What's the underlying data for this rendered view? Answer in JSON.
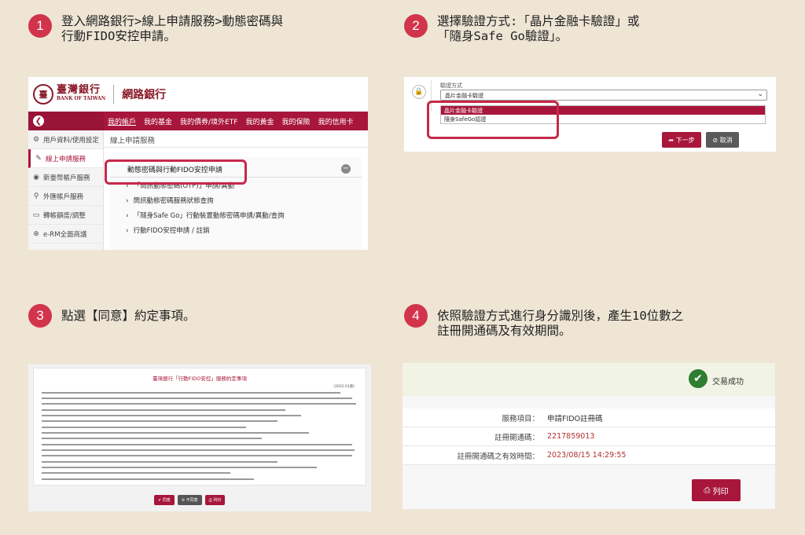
{
  "steps": [
    {
      "num": "1",
      "line1": "登入網路銀行>線上申請服務>動態密碼與",
      "line2": "行動FIDO安控申請。"
    },
    {
      "num": "2",
      "line1": "選擇驗證方式:「晶片金融卡驗證」或",
      "line2": "「隨身Safe Go驗證」。"
    },
    {
      "num": "3",
      "line1": "點選【同意】約定事項。"
    },
    {
      "num": "4",
      "line1": "依照驗證方式進行身分識別後，產生10位數之",
      "line2": "註冊開通碼及有效期間。"
    }
  ],
  "panel1": {
    "logo_zh": "臺灣銀行",
    "logo_en": "BANK OF TAIWAN",
    "site_title": "網路銀行",
    "nav": [
      "我的帳戶",
      "我的基金",
      "我的債券/境外ETF",
      "我的黃金",
      "我的保險",
      "我的信用卡"
    ],
    "sidebar": [
      {
        "icon": "gear-icon",
        "glyph": "⚙",
        "label": "用戶資料/使用設定"
      },
      {
        "icon": "edit-icon",
        "glyph": "✎",
        "label": "線上申請服務"
      },
      {
        "icon": "account-icon",
        "glyph": "◉",
        "label": "新臺幣帳戶服務"
      },
      {
        "icon": "location-icon",
        "glyph": "⚲",
        "label": "外匯帳戶服務"
      },
      {
        "icon": "folder-icon",
        "glyph": "▭",
        "label": "轉帳額度/調整"
      },
      {
        "icon": "globe-icon",
        "glyph": "⊕",
        "label": "e-RM全面商議"
      }
    ],
    "breadcrumb": "線上申請服務",
    "service_head": "動態密碼與行動FIDO安控申請",
    "service_items": [
      "「簡訊動態密碼(OTP)」申請/異動",
      "簡訊動態密碼服務狀態查詢",
      "「隨身Safe Go」行動裝置動態密碼申請/異動/查詢",
      "行動FIDO安控申請 / 註銷"
    ]
  },
  "panel2": {
    "field_label": "驗證方式",
    "selected": "晶片金融卡驗證",
    "options": [
      "晶片金融卡驗證",
      "隨身SafeGo認證"
    ],
    "next_label": "下一步",
    "cancel_label": "取消"
  },
  "panel3": {
    "doc_title": "臺灣銀行「行動FIDO安控」服務約定事項",
    "doc_date": "(2022.01版)",
    "agree_label": "同意",
    "disagree_label": "不同意",
    "print_label": "列印"
  },
  "panel4": {
    "status": "交易成功",
    "rows": [
      {
        "key": "服務項目：",
        "value": "申請FIDO註冊碼"
      },
      {
        "key": "註冊開通碼：",
        "value": "2217859013"
      },
      {
        "key": "註冊開通碼之有效時間：",
        "value": "2023/08/15 14:29:55"
      }
    ],
    "print_label": "列印"
  }
}
